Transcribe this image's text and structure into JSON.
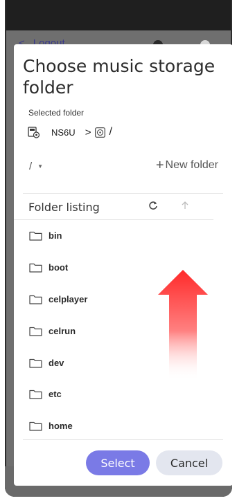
{
  "background": {
    "nav_label": "Logout",
    "nav_arrow": "<"
  },
  "dialog": {
    "title": "Choose music storage folder",
    "selected_folder_label": "Selected folder",
    "device_name": "NS6U",
    "path_separator": ">",
    "root_path": "/",
    "current_dir": "/",
    "new_folder_label": "New folder",
    "listing_header": "Folder listing",
    "folders": [
      {
        "name": "bin"
      },
      {
        "name": "boot"
      },
      {
        "name": "celplayer"
      },
      {
        "name": "celrun"
      },
      {
        "name": "dev"
      },
      {
        "name": "etc"
      },
      {
        "name": "home"
      }
    ],
    "select_label": "Select",
    "cancel_label": "Cancel"
  },
  "icons": {
    "device": "usb-drive-icon",
    "disk": "disk-icon",
    "folder": "folder-icon",
    "refresh": "refresh-icon",
    "up": "arrow-up-icon",
    "plus": "plus-icon",
    "caret": "caret-down-icon"
  },
  "colors": {
    "primary_button": "#7a7ae6",
    "secondary_button": "#e3e6ef",
    "scroll_arrow": "#ff2a2a"
  }
}
